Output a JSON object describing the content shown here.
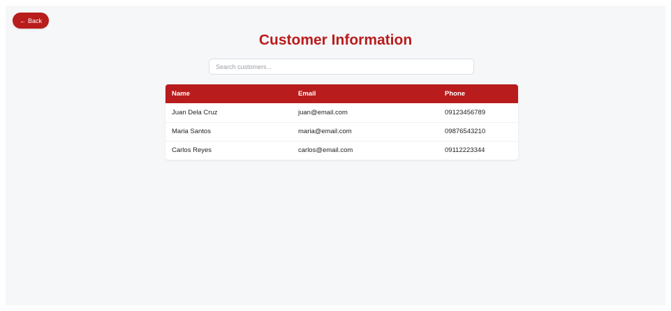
{
  "header": {
    "back_label": "Back",
    "back_arrow": "←",
    "title": "Customer Information"
  },
  "search": {
    "placeholder": "Search customers...",
    "value": ""
  },
  "table": {
    "columns": [
      "Name",
      "Email",
      "Phone"
    ],
    "rows": [
      [
        "Juan Dela Cruz",
        "juan@email.com",
        "09123456789"
      ],
      [
        "Maria Santos",
        "maria@email.com",
        "09876543210"
      ],
      [
        "Carlos Reyes",
        "carlos@email.com",
        "09112223344"
      ]
    ]
  },
  "colors": {
    "accent": "#b91c1c",
    "background": "#f6f7f9",
    "card": "#ffffff"
  }
}
